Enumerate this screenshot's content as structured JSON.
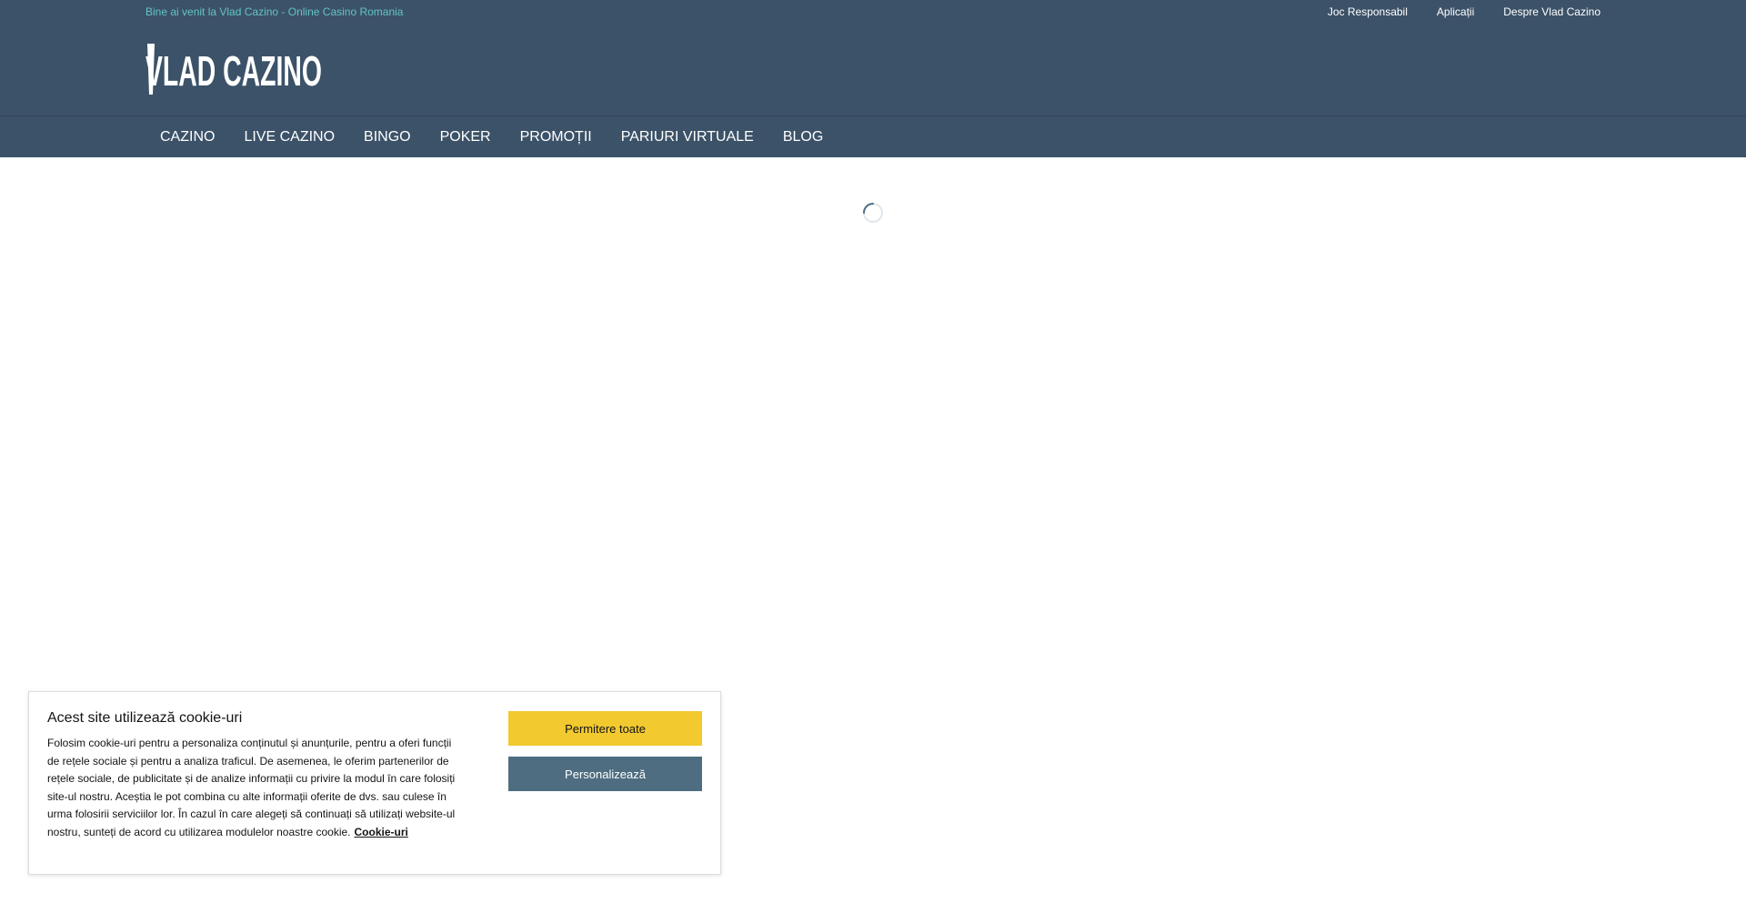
{
  "header": {
    "welcome": "Bine ai venit la Vlad Cazino - Online Casino Romania",
    "top_links": [
      "Joc Responsabil",
      "Aplicații",
      "Despre Vlad Cazino"
    ],
    "logo_text": "VLAD CAZINO"
  },
  "nav": {
    "items": [
      "CAZINO",
      "LIVE CAZINO",
      "BINGO",
      "POKER",
      "PROMOȚII",
      "PARIURI VIRTUALE",
      "BLOG"
    ]
  },
  "cookie": {
    "title": "Acest site utilizează cookie-uri",
    "text": "Folosim cookie-uri pentru a personaliza conținutul și anunțurile, pentru a oferi funcții de rețele sociale și pentru a analiza traficul. De asemenea, le oferim partenerilor de rețele sociale, de publicitate și de analize informații cu privire la modul în care folosiți site-ul nostru. Aceștia le pot combina cu alte informații oferite de dvs. sau culese în urma folosirii serviciilor lor. În cazul în care alegeți să continuați să utilizați website-ul nostru, sunteți de acord cu utilizarea modulelor noastre cookie.",
    "link": "Cookie-uri",
    "allow_label": "Permitere toate",
    "customize_label": "Personalizează"
  },
  "colors": {
    "header_bg": "#3c5268",
    "welcome_text": "#63c3c3",
    "allow_button": "#f2c92f",
    "customize_button": "#4e6d80"
  },
  "icons": {
    "loading": "loading-spinner-icon"
  }
}
